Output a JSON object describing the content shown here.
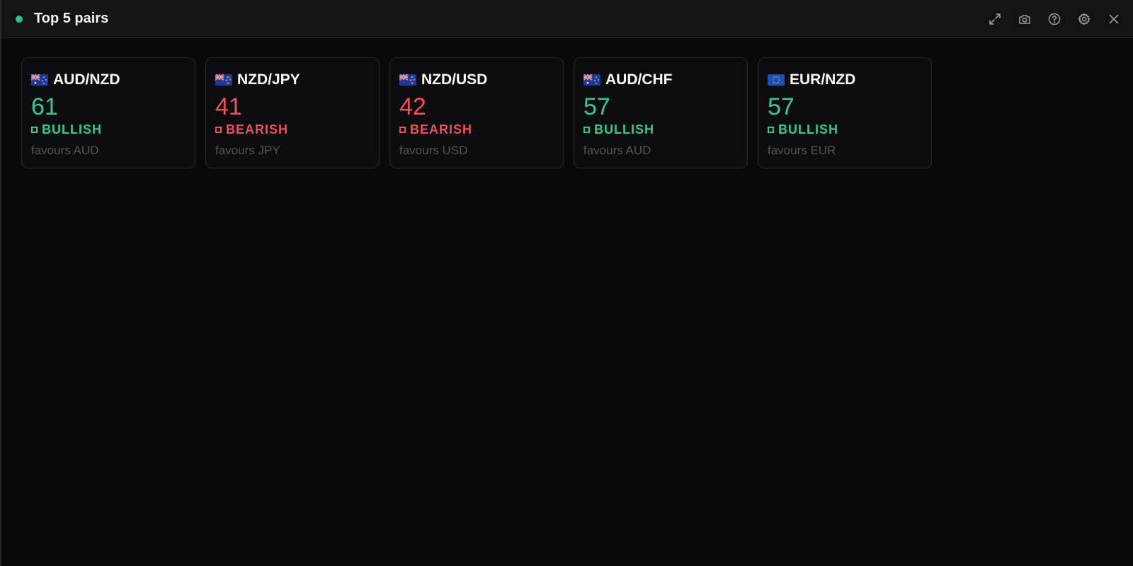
{
  "window": {
    "title": "Top 5 pairs",
    "status_color": "#22c58b"
  },
  "toolbar": {
    "icons": [
      "expand-icon",
      "camera-icon",
      "help-icon",
      "gear-icon",
      "close-icon"
    ]
  },
  "colors": {
    "bullish": "#2ecc8f",
    "bearish": "#ef4f5f"
  },
  "cards": [
    {
      "pair": "AUD/NZD",
      "flag": "australia-flag-icon",
      "score": "61",
      "signal": "BULLISH",
      "favour": "favours AUD"
    },
    {
      "pair": "NZD/JPY",
      "flag": "new-zealand-flag-icon",
      "score": "41",
      "signal": "BEARISH",
      "favour": "favours JPY"
    },
    {
      "pair": "NZD/USD",
      "flag": "new-zealand-flag-icon",
      "score": "42",
      "signal": "BEARISH",
      "favour": "favours USD"
    },
    {
      "pair": "AUD/CHF",
      "flag": "australia-flag-icon",
      "score": "57",
      "signal": "BULLISH",
      "favour": "favours AUD"
    },
    {
      "pair": "EUR/NZD",
      "flag": "eu-flag-icon",
      "score": "57",
      "signal": "BULLISH",
      "favour": "favours EUR"
    }
  ]
}
